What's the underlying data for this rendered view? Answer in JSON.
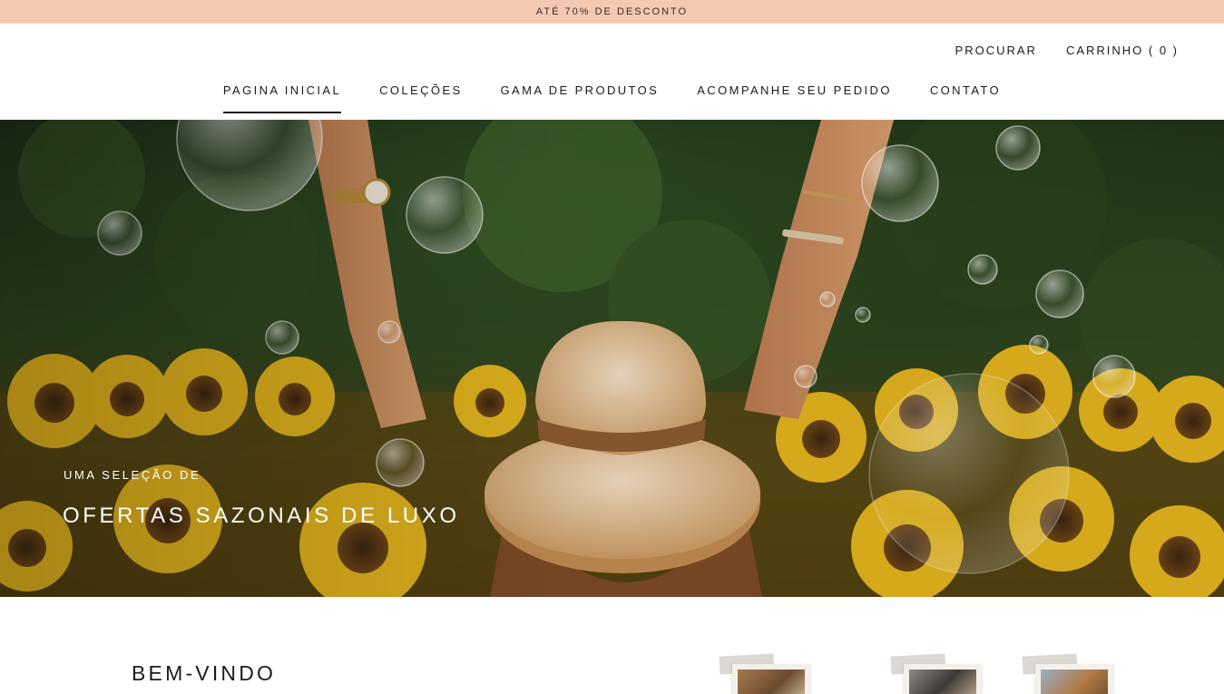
{
  "announcement": {
    "text": "ATÉ 70% DE DESCONTO"
  },
  "header": {
    "secondary_nav": {
      "search": "PROCURAR",
      "cart": "CARRINHO ( 0 )"
    },
    "main_nav": [
      {
        "label": "PAGINA INICIAL",
        "active": true
      },
      {
        "label": "COLEÇÕES"
      },
      {
        "label": "GAMA DE PRODUTOS"
      },
      {
        "label": "ACOMPANHE SEU PEDIDO"
      },
      {
        "label": "CONTATO"
      }
    ]
  },
  "hero": {
    "subheading": "UMA SELEÇÃO DE",
    "heading": "OFERTAS SAZONAIS DE LUXO"
  },
  "welcome": {
    "title": "BEM-VINDO"
  },
  "colors": {
    "announcement_bg": "#f3c9b1",
    "text": "#1c1b1b",
    "hero_foliage": "#2d461f",
    "sunflower": "#e0b21c"
  }
}
